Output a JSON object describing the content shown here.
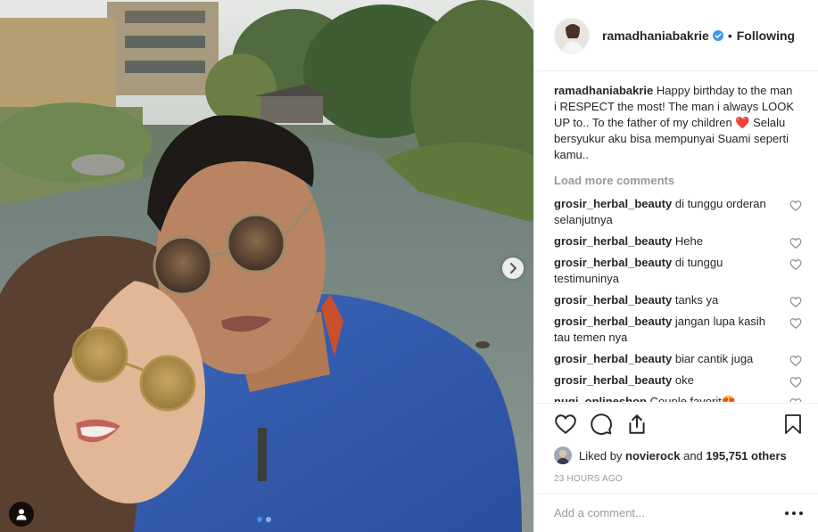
{
  "post": {
    "username": "ramadhaniabakrie",
    "separator": "•",
    "follow_label": "Following",
    "caption": {
      "username": "ramadhaniabakrie",
      "text_part1": "Happy birthday to the man i RESPECT the most! The man i always LOOK UP to.. To the father of my children ",
      "heart": "❤️",
      "text_part2": " Selalu bersyukur aku bisa mempunyai Suami seperti kamu.."
    },
    "load_more_label": "Load more comments",
    "comments": [
      {
        "username": "grosir_herbal_beauty",
        "text": "di tunggu orderan selanjutnya"
      },
      {
        "username": "grosir_herbal_beauty",
        "text": "Hehe"
      },
      {
        "username": "grosir_herbal_beauty",
        "text": "di tunggu testimuninya"
      },
      {
        "username": "grosir_herbal_beauty",
        "text": "tanks ya"
      },
      {
        "username": "grosir_herbal_beauty",
        "text": "jangan lupa kasih tau temen nya"
      },
      {
        "username": "grosir_herbal_beauty",
        "text": "biar cantik juga"
      },
      {
        "username": "grosir_herbal_beauty",
        "text": "oke"
      },
      {
        "username": "nugi_onlineshop",
        "text": "Couple favorit😍"
      }
    ],
    "likes": {
      "prefix": "Liked by",
      "user": "novierock",
      "joiner": "and",
      "others": "195,751 others"
    },
    "timestamp": "23 HOURS AGO",
    "comment_placeholder": "Add a comment...",
    "carousel": {
      "slide_count": 2,
      "active_index": 0
    }
  },
  "icons": {
    "verified": "verified-badge-icon",
    "like": "heart-outline-icon",
    "comment": "comment-bubble-icon",
    "share": "share-icon",
    "save": "bookmark-icon",
    "more": "ellipsis-icon",
    "next": "chevron-right-icon",
    "tag": "person-tag-icon"
  },
  "colors": {
    "accent_blue": "#3897f0",
    "text": "#262626",
    "muted": "#999999",
    "border": "#efefef",
    "heart_red": "#e0245e"
  }
}
